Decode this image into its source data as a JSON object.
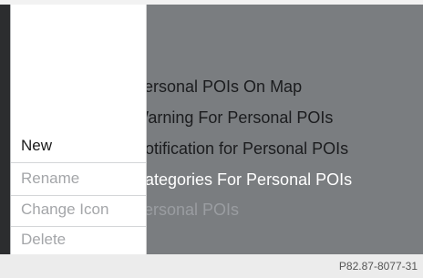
{
  "background_list": {
    "items": [
      {
        "label": "Personal POIs On Map",
        "state": "normal"
      },
      {
        "label": "Warning For Personal POIs",
        "state": "normal"
      },
      {
        "label": "Notification for Personal POIs",
        "state": "normal"
      },
      {
        "label": "Categories For Personal POIs",
        "state": "highlighted"
      },
      {
        "label": "Personal POIs",
        "state": "faded"
      }
    ]
  },
  "context_menu": {
    "items": [
      {
        "label": "New",
        "enabled": true
      },
      {
        "label": "Rename",
        "enabled": false
      },
      {
        "label": "Change Icon",
        "enabled": false
      },
      {
        "label": "Delete",
        "enabled": false
      }
    ]
  },
  "caption": {
    "ref_code": "P82.87-8077-31"
  },
  "colors": {
    "screen_background": "#7a7d80",
    "menu_background": "#ffffff",
    "highlight_text": "#ffffff",
    "disabled_text": "#a4a6a9"
  }
}
